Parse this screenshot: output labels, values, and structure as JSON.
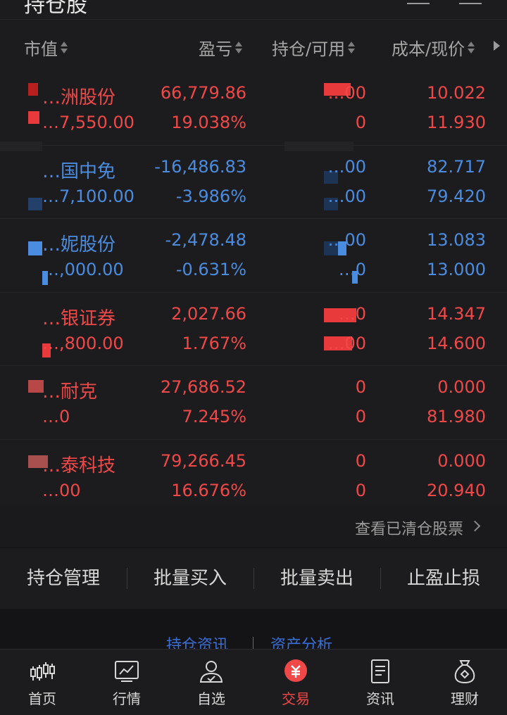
{
  "page": {
    "title": "持仓股"
  },
  "columns": {
    "market_value": "市值",
    "profit_loss": "盈亏",
    "holding_available": "持仓/可用",
    "cost_price": "成本/现价"
  },
  "rows": [
    {
      "name": "…洲股份",
      "market_value": "…7,550.00",
      "pl": "66,779.86",
      "pl_pct": "19.038%",
      "holding": "…00",
      "available": "0",
      "cost": "10.022",
      "price": "11.930",
      "trend": "up"
    },
    {
      "name": "…国中免",
      "market_value": "…7,100.00",
      "pl": "-16,486.83",
      "pl_pct": "-3.986%",
      "holding": "…00",
      "available": "…00",
      "cost": "82.717",
      "price": "79.420",
      "trend": "down"
    },
    {
      "name": "…妮股份",
      "market_value": "…,000.00",
      "pl": "-2,478.48",
      "pl_pct": "-0.631%",
      "holding": "…00",
      "available": "…0",
      "cost": "13.083",
      "price": "13.000",
      "trend": "down"
    },
    {
      "name": "…银证券",
      "market_value": "…,800.00",
      "pl": "2,027.66",
      "pl_pct": "1.767%",
      "holding": "…0",
      "available": "…00",
      "cost": "14.347",
      "price": "14.600",
      "trend": "up"
    },
    {
      "name": "…耐克",
      "market_value": "…0",
      "pl": "27,686.52",
      "pl_pct": "7.245%",
      "holding": "0",
      "available": "0",
      "cost": "0.000",
      "price": "81.980",
      "trend": "up"
    },
    {
      "name": "…泰科技",
      "market_value": "…00",
      "pl": "79,266.45",
      "pl_pct": "16.676%",
      "holding": "0",
      "available": "0",
      "cost": "0.000",
      "price": "20.940",
      "trend": "up"
    }
  ],
  "cleared": {
    "label": "查看已清仓股票"
  },
  "actions": [
    "持仓管理",
    "批量买入",
    "批量卖出",
    "止盈止损"
  ],
  "links": {
    "holding_news": "持仓资讯",
    "asset_analysis": "资产分析"
  },
  "tabs": [
    {
      "label": "首页",
      "icon": "candlestick-icon"
    },
    {
      "label": "行情",
      "icon": "chart-icon"
    },
    {
      "label": "自选",
      "icon": "user-icon"
    },
    {
      "label": "交易",
      "icon": "yuan-icon",
      "active": true
    },
    {
      "label": "资讯",
      "icon": "document-icon"
    },
    {
      "label": "理财",
      "icon": "money-bag-icon"
    }
  ],
  "colors": {
    "up": "#f04848",
    "down": "#4a8ce0",
    "accent": "#f04848",
    "link": "#3a6fd8"
  }
}
